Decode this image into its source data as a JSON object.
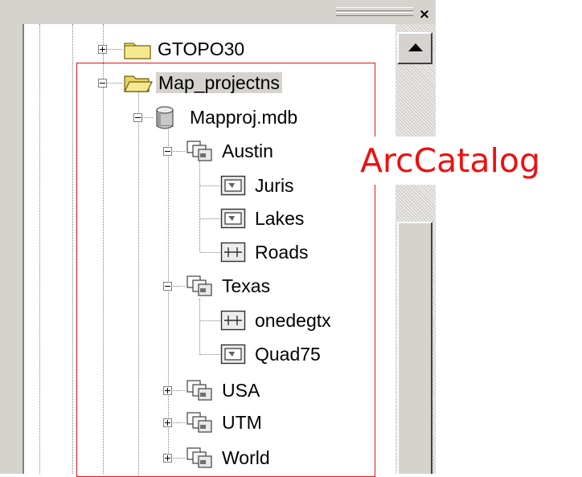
{
  "window": {
    "close_glyph": "×"
  },
  "tree": {
    "nodes": [
      {
        "label": "GTOPO30",
        "icon": "folder-icon",
        "expander": "plus"
      },
      {
        "label": "Map_projectns",
        "icon": "folder-open-icon",
        "expander": "minus",
        "selected": true
      },
      {
        "label": "Mapproj.mdb",
        "icon": "database-icon",
        "expander": "minus"
      },
      {
        "label": "Austin",
        "icon": "feature-dataset-icon",
        "expander": "minus"
      },
      {
        "label": "Juris",
        "icon": "polygon-feature-class-icon"
      },
      {
        "label": "Lakes",
        "icon": "polygon-feature-class-icon"
      },
      {
        "label": "Roads",
        "icon": "line-feature-class-icon"
      },
      {
        "label": "Texas",
        "icon": "feature-dataset-icon",
        "expander": "minus"
      },
      {
        "label": "onedegtx",
        "icon": "line-feature-class-icon"
      },
      {
        "label": "Quad75",
        "icon": "polygon-feature-class-icon"
      },
      {
        "label": "USA",
        "icon": "feature-dataset-icon",
        "expander": "plus"
      },
      {
        "label": "UTM",
        "icon": "feature-dataset-icon",
        "expander": "plus"
      },
      {
        "label": "World",
        "icon": "feature-dataset-icon",
        "expander": "plus"
      }
    ]
  },
  "annotation": {
    "callout_text": "ArcCatalog",
    "color": "#ee1010"
  }
}
